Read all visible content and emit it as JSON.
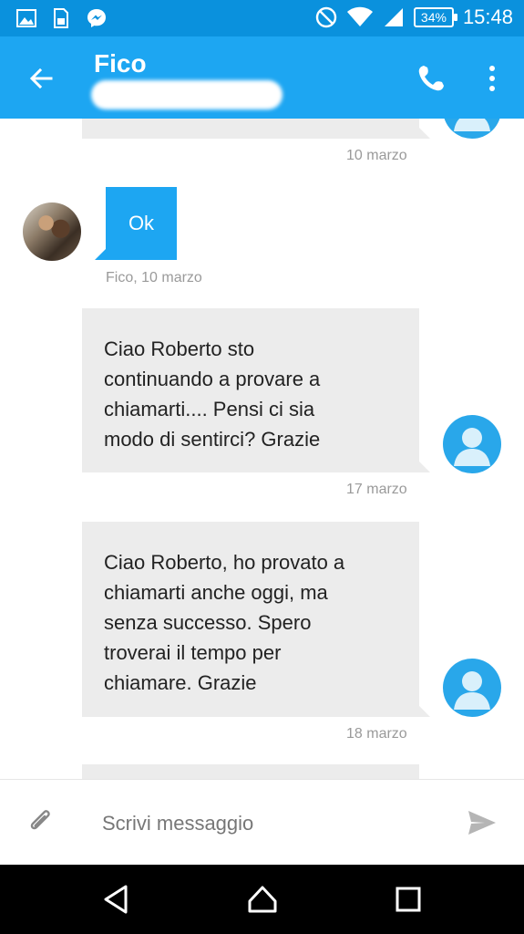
{
  "status_bar": {
    "time": "15:48",
    "battery": "34%",
    "icons": [
      "image-icon",
      "sim-icon",
      "messenger-icon",
      "do-not-disturb-icon",
      "wifi-icon",
      "signal-icon",
      "battery-icon"
    ]
  },
  "header": {
    "title": "Fico",
    "icons": [
      "back-arrow-icon",
      "phone-icon",
      "overflow-menu-icon"
    ]
  },
  "messages": [
    {
      "direction": "out",
      "text": "",
      "timestamp": "10 marzo"
    },
    {
      "direction": "in",
      "text": "Ok",
      "timestamp": "Fico, 10 marzo"
    },
    {
      "direction": "out",
      "lines": [
        "Ciao Roberto sto",
        "continuando a provare a",
        "chiamarti....  Pensi ci sia",
        "modo di sentirci?  Grazie"
      ],
      "timestamp": "17 marzo"
    },
    {
      "direction": "out",
      "lines": [
        "Ciao Roberto,  ho provato a",
        "chiamarti anche oggi, ma",
        "senza successo.  Spero",
        "troverai il tempo per",
        "chiamare. Grazie"
      ],
      "timestamp": "18 marzo"
    }
  ],
  "composer": {
    "placeholder": "Scrivi messaggio",
    "icons": [
      "attach-icon",
      "send-icon"
    ]
  },
  "nav": {
    "icons": [
      "back-triangle-icon",
      "home-icon",
      "recents-icon"
    ]
  },
  "colors": {
    "status_bar": "#0a91dd",
    "app_bar": "#1da6f2",
    "bubble_out": "#ececec",
    "avatar_default": "#29a7ea"
  }
}
